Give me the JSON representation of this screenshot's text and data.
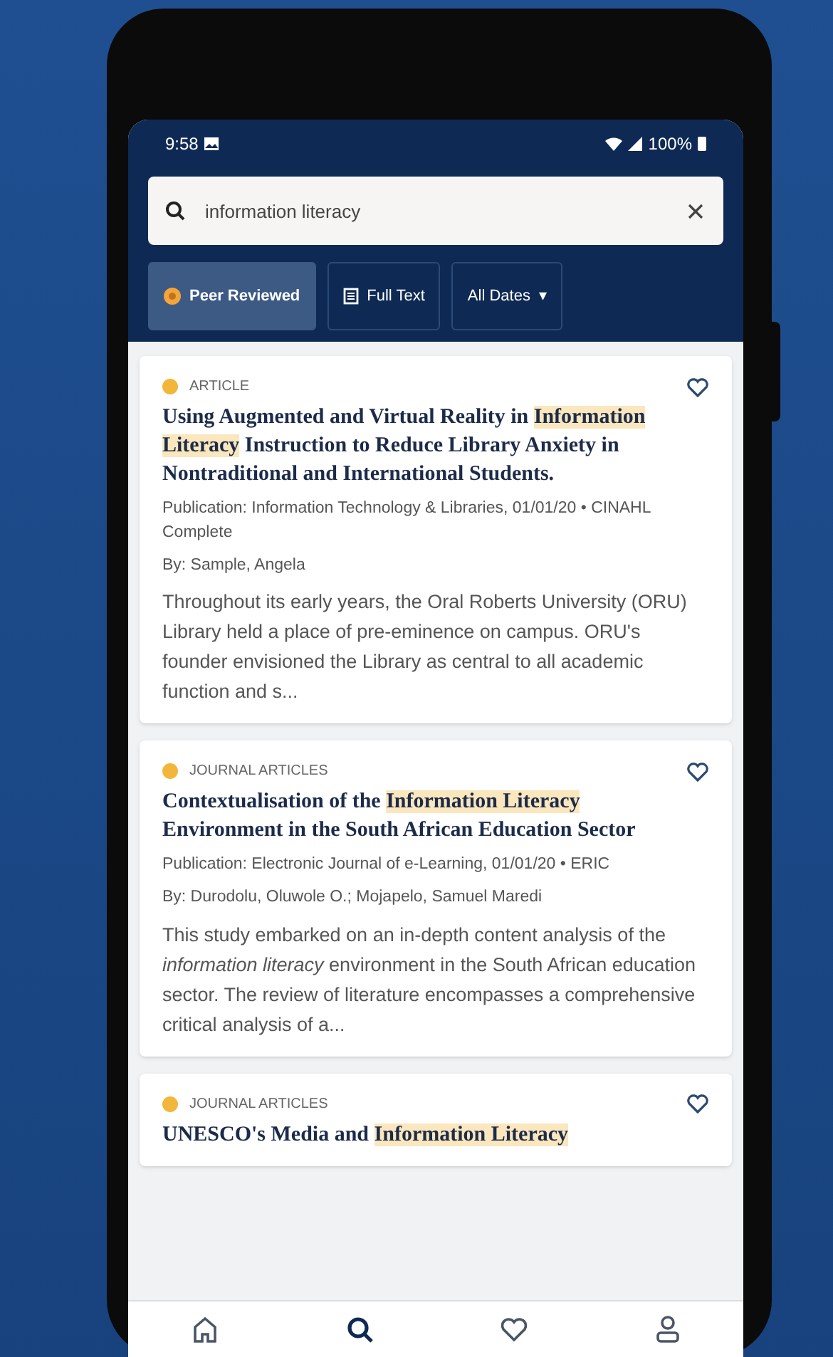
{
  "status_bar": {
    "time": "9:58",
    "battery": "100%"
  },
  "search": {
    "value": "information literacy"
  },
  "filters": [
    {
      "kind": "dot",
      "label": "Peer Reviewed",
      "selected": true
    },
    {
      "kind": "doc",
      "label": "Full Text",
      "selected": false
    },
    {
      "kind": "dropdown",
      "label": "All Dates",
      "caret": "▾",
      "selected": false
    }
  ],
  "results": [
    {
      "type": "ARTICLE",
      "title_parts": [
        {
          "text": "Using Augmented and Virtual Reality in ",
          "highlighted": false
        },
        {
          "text": "Information Literacy",
          "highlighted": true
        },
        {
          "text": " Instruction to Reduce Library Anxiety in Nontraditional and International Students.",
          "highlighted": false
        }
      ],
      "publication": "Publication: Information Technology & Libraries, 01/01/20 • CINAHL Complete",
      "authors": "By: Sample, Angela",
      "abstract": "Throughout its early years, the Oral Roberts University (ORU) Library held a place of pre-eminence on campus. ORU's founder envisioned the Library as central to all academic function and s..."
    },
    {
      "type": "JOURNAL ARTICLES",
      "title_parts": [
        {
          "text": "Contextualisation of the ",
          "highlighted": false
        },
        {
          "text": "Information Literacy",
          "highlighted": true
        },
        {
          "text": " Environment in the South African Education Sector",
          "highlighted": false
        }
      ],
      "publication": "Publication: Electronic Journal of e-Learning, 01/01/20 • ERIC",
      "authors": "By: Durodolu, Oluwole O.; Mojapelo, Samuel Maredi",
      "abstract": "This study embarked on an in-depth content analysis of the *information literacy* environment in the South African education sector. The review of literature encompasses a comprehensive critical analysis of a..."
    },
    {
      "type": "JOURNAL ARTICLES",
      "title_parts": [
        {
          "text": "UNESCO's Media and ",
          "highlighted": false
        },
        {
          "text": "Information Literacy",
          "highlighted": true
        }
      ]
    }
  ],
  "nav": [
    {
      "kind": "home",
      "selected": false
    },
    {
      "kind": "search",
      "selected": true
    },
    {
      "kind": "heart",
      "selected": false
    },
    {
      "kind": "person",
      "selected": false
    }
  ]
}
